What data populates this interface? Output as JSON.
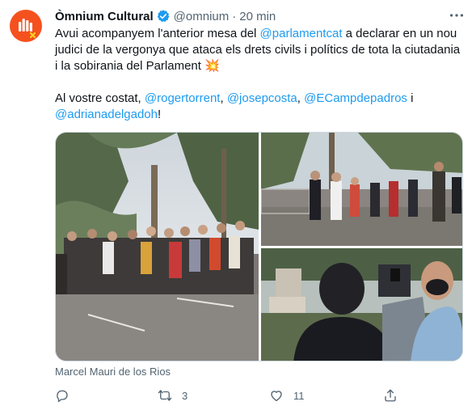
{
  "author": {
    "name": "Òmnium Cultural",
    "handle": "@omnium",
    "separator": "·",
    "time": "20 min"
  },
  "text": {
    "line1": {
      "pre": "Avui acompanyem l'anterior mesa del ",
      "mention": "@parlamentcat",
      "post": " a declarar en un nou judici de la vergonya que ataca els drets civils i polítics de tota la ciutadania i la sobirania del Parlament ",
      "emoji": "💥"
    },
    "line2": {
      "pre": "Al vostre costat, ",
      "m1": "@rogertorrent",
      "s1": ", ",
      "m2": "@josepcosta",
      "s2": ", ",
      "m3": "@ECampdepadros",
      "s3": " i ",
      "m4": "@adrianadelgadoh",
      "post": "!"
    }
  },
  "media_credit": "Marcel Mauri de los Rios",
  "actions": {
    "reply_count": "",
    "retweet_count": "3",
    "like_count": "11"
  },
  "icons": [
    "omnium-logo-icon",
    "verified-badge-icon",
    "more-options-icon",
    "reply-icon",
    "retweet-icon",
    "like-icon",
    "share-icon"
  ],
  "colors": {
    "brand": "#f5511e",
    "verified": "#1d9bf0",
    "mention": "#1d9bf0",
    "secondary_text": "#536471"
  }
}
